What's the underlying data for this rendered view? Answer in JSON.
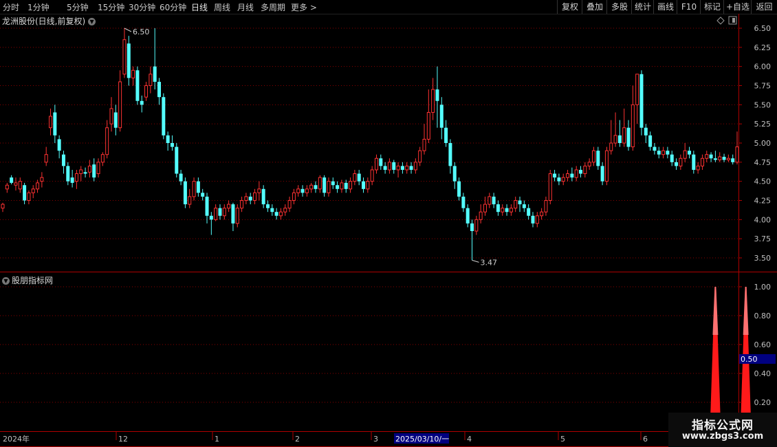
{
  "toolbar": {
    "periods": [
      "分时",
      "1分钟",
      "5分钟",
      "15分钟",
      "30分钟",
      "60分钟",
      "日线",
      "周线",
      "月线",
      "多周期",
      "更多"
    ],
    "active_period": "日线",
    "more_arrow": ">",
    "right_buttons": [
      "复权",
      "叠加",
      "多股",
      "统计",
      "画线",
      "F10",
      "标记",
      "+自选",
      "返回"
    ]
  },
  "main": {
    "title": "龙洲股份(日线,前复权)",
    "price_axis": [
      "6.50",
      "6.25",
      "6.00",
      "5.75",
      "5.50",
      "5.25",
      "5.00",
      "4.75",
      "4.50",
      "4.25",
      "4.00",
      "3.75",
      "3.50"
    ],
    "high_label": "6.50",
    "low_label": "3.47"
  },
  "indicator": {
    "title": "股朋指标网",
    "axis": [
      "1.00",
      "0.80",
      "0.60",
      "0.40",
      "0.20"
    ],
    "current_value": "0.50"
  },
  "date_axis": {
    "labels": [
      "2024年",
      "12",
      "1",
      "2",
      "3",
      "2025/03/10/一",
      "4",
      "5",
      "6"
    ]
  },
  "watermark": {
    "line1": "指标公式网",
    "line2": "www.zbgs3.com"
  },
  "colors": {
    "up": "#ff3232",
    "down": "#54ffff",
    "grid": "#8b0000",
    "axis_line": "#b00000",
    "spike": "#ff1a1a",
    "spike_top": "#ff8080",
    "highlight": "#000080"
  },
  "chart_data": [
    {
      "type": "candlestick",
      "ylim": [
        3.4,
        6.6
      ],
      "candles": [
        [
          4.15,
          4.2,
          4.1,
          4.22
        ],
        [
          4.4,
          4.45,
          4.35,
          4.48
        ],
        [
          4.55,
          4.48,
          4.46,
          4.58
        ],
        [
          4.45,
          4.48,
          4.38,
          4.55
        ],
        [
          4.4,
          4.5,
          4.35,
          4.55
        ],
        [
          4.45,
          4.25,
          4.2,
          4.48
        ],
        [
          4.25,
          4.35,
          4.2,
          4.38
        ],
        [
          4.35,
          4.4,
          4.28,
          4.45
        ],
        [
          4.4,
          4.48,
          4.35,
          4.52
        ],
        [
          4.5,
          4.55,
          4.42,
          4.62
        ],
        [
          4.75,
          4.85,
          4.7,
          4.95
        ],
        [
          5.2,
          5.35,
          5.1,
          5.45
        ],
        [
          5.4,
          5.1,
          5.0,
          5.5
        ],
        [
          5.05,
          4.9,
          4.8,
          5.1
        ],
        [
          4.85,
          4.7,
          4.6,
          4.9
        ],
        [
          4.7,
          4.5,
          4.45,
          4.75
        ],
        [
          4.55,
          4.48,
          4.42,
          4.65
        ],
        [
          4.5,
          4.6,
          4.4,
          4.65
        ],
        [
          4.6,
          4.65,
          4.5,
          4.7
        ],
        [
          4.62,
          4.6,
          4.55,
          4.68
        ],
        [
          4.62,
          4.7,
          4.55,
          4.78
        ],
        [
          4.72,
          4.55,
          4.5,
          4.8
        ],
        [
          4.6,
          4.75,
          4.55,
          4.8
        ],
        [
          4.75,
          4.85,
          4.7,
          4.88
        ],
        [
          4.85,
          5.2,
          4.8,
          5.3
        ],
        [
          5.25,
          5.45,
          5.15,
          5.6
        ],
        [
          5.4,
          5.2,
          5.1,
          5.5
        ],
        [
          5.2,
          5.8,
          5.15,
          5.95
        ],
        [
          5.9,
          6.35,
          5.85,
          6.5
        ],
        [
          6.3,
          5.85,
          5.75,
          6.4
        ],
        [
          5.85,
          5.95,
          5.75,
          6.0
        ],
        [
          5.95,
          5.55,
          5.5,
          6.0
        ],
        [
          5.55,
          5.5,
          5.4,
          5.62
        ],
        [
          5.6,
          5.75,
          5.55,
          5.8
        ],
        [
          5.75,
          5.9,
          5.65,
          6.0
        ],
        [
          6.0,
          5.8,
          5.7,
          6.5
        ],
        [
          5.8,
          5.6,
          5.5,
          5.85
        ],
        [
          5.6,
          5.1,
          5.05,
          5.65
        ],
        [
          5.1,
          5.0,
          4.9,
          5.15
        ],
        [
          5.0,
          4.95,
          4.9,
          5.1
        ],
        [
          4.95,
          4.6,
          4.55,
          5.0
        ],
        [
          4.6,
          4.5,
          4.45,
          4.65
        ],
        [
          4.5,
          4.2,
          4.15,
          4.55
        ],
        [
          4.2,
          4.3,
          4.15,
          4.4
        ],
        [
          4.3,
          4.5,
          4.25,
          4.55
        ],
        [
          4.5,
          4.35,
          4.3,
          4.55
        ],
        [
          4.35,
          4.3,
          4.25,
          4.4
        ],
        [
          4.3,
          4.05,
          3.95,
          4.35
        ],
        [
          4.05,
          4.0,
          3.8,
          4.1
        ],
        [
          4.0,
          4.15,
          3.98,
          4.2
        ],
        [
          4.15,
          4.05,
          4.0,
          4.2
        ],
        [
          4.05,
          4.15,
          4.0,
          4.2
        ],
        [
          4.15,
          4.2,
          4.1,
          4.25
        ],
        [
          4.2,
          3.95,
          3.85,
          4.22
        ],
        [
          3.95,
          4.15,
          3.9,
          4.2
        ],
        [
          4.15,
          4.25,
          4.1,
          4.3
        ],
        [
          4.25,
          4.3,
          4.2,
          4.35
        ],
        [
          4.3,
          4.25,
          4.2,
          4.35
        ],
        [
          4.25,
          4.35,
          4.2,
          4.4
        ],
        [
          4.35,
          4.4,
          4.25,
          4.5
        ],
        [
          4.4,
          4.2,
          4.15,
          4.45
        ],
        [
          4.2,
          4.15,
          4.1,
          4.25
        ],
        [
          4.15,
          4.1,
          4.05,
          4.2
        ],
        [
          4.1,
          4.05,
          4.0,
          4.15
        ],
        [
          4.05,
          4.1,
          4.0,
          4.15
        ],
        [
          4.1,
          4.15,
          4.05,
          4.2
        ],
        [
          4.15,
          4.25,
          4.1,
          4.3
        ],
        [
          4.25,
          4.35,
          4.2,
          4.4
        ],
        [
          4.35,
          4.4,
          4.3,
          4.45
        ],
        [
          4.4,
          4.35,
          4.3,
          4.45
        ],
        [
          4.35,
          4.4,
          4.3,
          4.45
        ],
        [
          4.4,
          4.45,
          4.35,
          4.48
        ],
        [
          4.45,
          4.4,
          4.35,
          4.5
        ],
        [
          4.4,
          4.55,
          4.35,
          4.58
        ],
        [
          4.55,
          4.35,
          4.3,
          4.58
        ],
        [
          4.35,
          4.5,
          4.3,
          4.55
        ],
        [
          4.5,
          4.45,
          4.4,
          4.55
        ],
        [
          4.45,
          4.4,
          4.35,
          4.5
        ],
        [
          4.4,
          4.48,
          4.35,
          4.52
        ],
        [
          4.48,
          4.4,
          4.35,
          4.52
        ],
        [
          4.4,
          4.5,
          4.35,
          4.55
        ],
        [
          4.5,
          4.6,
          4.45,
          4.65
        ],
        [
          4.6,
          4.5,
          4.45,
          4.65
        ],
        [
          4.5,
          4.4,
          4.35,
          4.55
        ],
        [
          4.4,
          4.5,
          4.35,
          4.55
        ],
        [
          4.5,
          4.65,
          4.45,
          4.7
        ],
        [
          4.65,
          4.8,
          4.6,
          4.85
        ],
        [
          4.8,
          4.7,
          4.65,
          4.85
        ],
        [
          4.7,
          4.65,
          4.6,
          4.75
        ],
        [
          4.65,
          4.75,
          4.6,
          4.8
        ],
        [
          4.75,
          4.65,
          4.6,
          4.78
        ],
        [
          4.65,
          4.7,
          4.55,
          4.75
        ],
        [
          4.7,
          4.65,
          4.6,
          4.75
        ],
        [
          4.65,
          4.7,
          4.6,
          4.75
        ],
        [
          4.7,
          4.65,
          4.6,
          4.75
        ],
        [
          4.65,
          4.75,
          4.6,
          4.8
        ],
        [
          4.75,
          4.9,
          4.7,
          4.95
        ],
        [
          4.9,
          5.05,
          4.85,
          5.25
        ],
        [
          5.05,
          5.4,
          5.0,
          5.7
        ],
        [
          5.4,
          5.7,
          5.3,
          5.85
        ],
        [
          5.7,
          5.55,
          5.2,
          6.0
        ],
        [
          5.5,
          5.2,
          5.05,
          5.6
        ],
        [
          5.2,
          5.0,
          4.95,
          5.3
        ],
        [
          5.0,
          4.7,
          4.6,
          5.05
        ],
        [
          4.7,
          4.5,
          4.4,
          4.75
        ],
        [
          4.5,
          4.3,
          4.25,
          4.55
        ],
        [
          4.3,
          4.15,
          4.1,
          4.35
        ],
        [
          4.15,
          3.95,
          3.9,
          4.2
        ],
        [
          3.95,
          3.85,
          3.47,
          4.0
        ],
        [
          3.85,
          4.0,
          3.8,
          4.05
        ],
        [
          4.0,
          4.1,
          3.95,
          4.2
        ],
        [
          4.1,
          4.2,
          4.05,
          4.3
        ],
        [
          4.2,
          4.3,
          4.15,
          4.35
        ],
        [
          4.3,
          4.2,
          4.15,
          4.35
        ],
        [
          4.2,
          4.1,
          4.05,
          4.25
        ],
        [
          4.1,
          4.15,
          4.05,
          4.2
        ],
        [
          4.15,
          4.1,
          4.05,
          4.2
        ],
        [
          4.1,
          4.15,
          4.05,
          4.2
        ],
        [
          4.15,
          4.25,
          4.1,
          4.3
        ],
        [
          4.25,
          4.2,
          4.1,
          4.3
        ],
        [
          4.2,
          4.15,
          4.1,
          4.25
        ],
        [
          4.15,
          4.05,
          4.0,
          4.2
        ],
        [
          4.05,
          3.95,
          3.9,
          4.1
        ],
        [
          3.95,
          4.05,
          3.9,
          4.1
        ],
        [
          4.05,
          4.1,
          4.0,
          4.15
        ],
        [
          4.1,
          4.25,
          4.05,
          4.3
        ],
        [
          4.25,
          4.6,
          4.2,
          4.65
        ],
        [
          4.6,
          4.55,
          4.5,
          4.65
        ],
        [
          4.55,
          4.5,
          4.45,
          4.6
        ],
        [
          4.5,
          4.55,
          4.45,
          4.6
        ],
        [
          4.55,
          4.6,
          4.5,
          4.65
        ],
        [
          4.6,
          4.55,
          4.5,
          4.68
        ],
        [
          4.55,
          4.65,
          4.5,
          4.7
        ],
        [
          4.65,
          4.6,
          4.55,
          4.7
        ],
        [
          4.6,
          4.7,
          4.55,
          4.75
        ],
        [
          4.7,
          4.75,
          4.65,
          4.8
        ],
        [
          4.75,
          4.9,
          4.7,
          4.95
        ],
        [
          4.9,
          4.7,
          4.65,
          4.95
        ],
        [
          4.7,
          4.5,
          4.45,
          4.75
        ],
        [
          4.5,
          4.9,
          4.45,
          4.95
        ],
        [
          4.9,
          5.0,
          4.85,
          5.3
        ],
        [
          5.0,
          5.1,
          4.95,
          5.4
        ],
        [
          5.1,
          5.0,
          4.95,
          5.3
        ],
        [
          5.0,
          5.2,
          4.95,
          5.45
        ],
        [
          5.2,
          4.95,
          4.9,
          5.3
        ],
        [
          4.95,
          5.5,
          4.9,
          5.75
        ],
        [
          5.5,
          5.9,
          5.25,
          5.9
        ],
        [
          5.9,
          5.2,
          5.1,
          5.95
        ],
        [
          5.2,
          5.1,
          5.0,
          5.25
        ],
        [
          5.1,
          4.95,
          4.9,
          5.15
        ],
        [
          4.95,
          4.9,
          4.85,
          5.0
        ],
        [
          4.9,
          4.85,
          4.8,
          4.95
        ],
        [
          4.85,
          4.9,
          4.8,
          4.95
        ],
        [
          4.9,
          4.85,
          4.8,
          4.95
        ],
        [
          4.85,
          4.75,
          4.7,
          4.9
        ],
        [
          4.75,
          4.7,
          4.65,
          4.8
        ],
        [
          4.7,
          4.8,
          4.65,
          4.85
        ],
        [
          4.8,
          4.9,
          4.75,
          5.0
        ],
        [
          4.9,
          4.85,
          4.8,
          4.95
        ],
        [
          4.85,
          4.65,
          4.6,
          4.9
        ],
        [
          4.65,
          4.7,
          4.6,
          4.75
        ],
        [
          4.7,
          4.8,
          4.65,
          4.85
        ],
        [
          4.8,
          4.85,
          4.75,
          4.9
        ],
        [
          4.85,
          4.8,
          4.75,
          4.88
        ],
        [
          4.8,
          4.78,
          4.75,
          4.9
        ],
        [
          4.78,
          4.82,
          4.75,
          4.88
        ],
        [
          4.82,
          4.78,
          4.75,
          4.86
        ],
        [
          4.78,
          4.8,
          4.75,
          4.85
        ],
        [
          4.8,
          4.75,
          4.72,
          4.85
        ],
        [
          4.75,
          4.95,
          4.72,
          5.15
        ]
      ]
    },
    {
      "type": "area",
      "ylim": [
        0,
        1.1
      ],
      "spikes": [
        {
          "index": 164,
          "value": 1.0
        },
        {
          "index": 171,
          "value": 1.0
        }
      ]
    }
  ]
}
